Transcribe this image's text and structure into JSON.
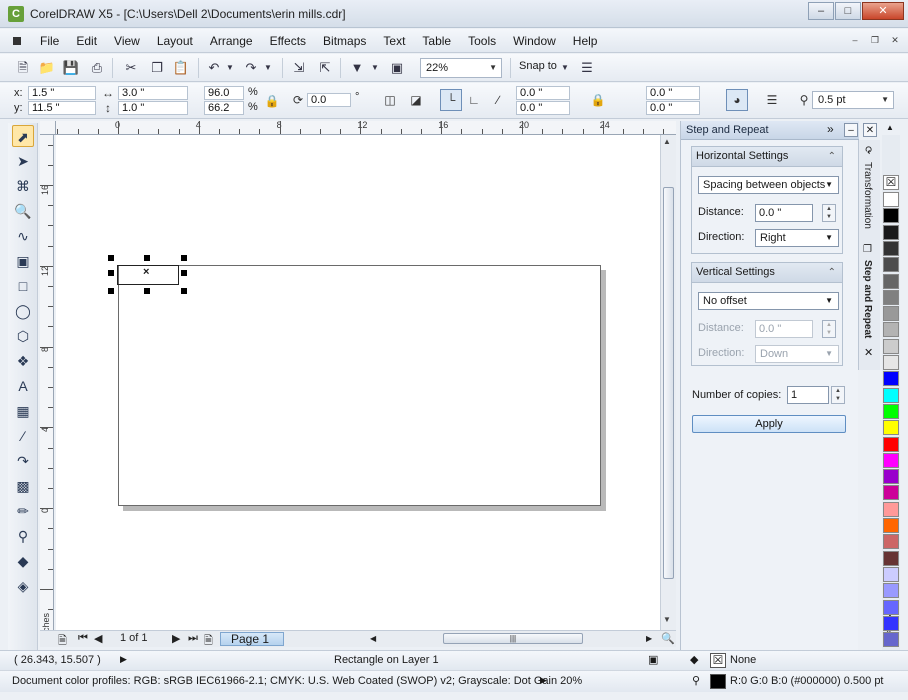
{
  "window": {
    "title": "CorelDRAW X5 - [C:\\Users\\Dell 2\\Documents\\erin mills.cdr]",
    "app_icon_letter": "C"
  },
  "menu": [
    "File",
    "Edit",
    "View",
    "Layout",
    "Arrange",
    "Effects",
    "Bitmaps",
    "Text",
    "Table",
    "Tools",
    "Window",
    "Help"
  ],
  "toolbar": {
    "zoom": "22%",
    "snap_label": "Snap to"
  },
  "property_bar": {
    "x_label": "x:",
    "x_value": "1.5 \"",
    "y_label": "y:",
    "y_value": "11.5 \"",
    "width_value": "3.0 \"",
    "height_value": "1.0 \"",
    "scale_w": "96.0",
    "scale_h": "66.2",
    "pct": "%",
    "rotation": "0.0",
    "degree": "°",
    "corner1": "0.0 \"",
    "corner2": "0.0 \"",
    "corner3": "0.0 \"",
    "corner4": "0.0 \"",
    "outline_width": "0.5 pt"
  },
  "ruler": {
    "units": "inches",
    "top_labels": [
      "0",
      "4",
      "8",
      "12",
      "16",
      "20",
      "24"
    ],
    "left_labels": [
      "16",
      "12",
      "8",
      "4",
      "0"
    ],
    "left_units": "inches"
  },
  "page_nav": {
    "page_count": "1 of 1",
    "page_tab": "Page 1"
  },
  "docker": {
    "title": "Step and Repeat",
    "horizontal": {
      "title": "Horizontal Settings",
      "mode": "Spacing between objects",
      "distance_label": "Distance:",
      "distance_value": "0.0 \"",
      "direction_label": "Direction:",
      "direction_value": "Right"
    },
    "vertical": {
      "title": "Vertical Settings",
      "mode": "No offset",
      "distance_label": "Distance:",
      "distance_value": "0.0 \"",
      "direction_label": "Direction:",
      "direction_value": "Down"
    },
    "copies_label": "Number of copies:",
    "copies_value": "1",
    "apply_label": "Apply",
    "tabs": [
      "Transformation",
      "Step and Repeat"
    ]
  },
  "palette_colors": [
    "#ffffff",
    "#000000",
    "#1a1a1a",
    "#333333",
    "#4d4d4d",
    "#666666",
    "#808080",
    "#999999",
    "#b3b3b3",
    "#cccccc",
    "#e6e6e6",
    "#0000ff",
    "#00ffff",
    "#00ff00",
    "#ffff00",
    "#ff0000",
    "#ff00ff",
    "#9900cc",
    "#cc0099",
    "#ff9999",
    "#ff6600",
    "#cc6666",
    "#663333",
    "#ccccff",
    "#9999ff",
    "#6666ff",
    "#3333ff",
    "#6666cc"
  ],
  "status": {
    "coords": "( 26.343, 15.507 )",
    "object_info": "Rectangle on Layer 1",
    "fill_label": "None",
    "color_profiles": "Document color profiles: RGB: sRGB IEC61966-2.1; CMYK: U.S. Web Coated (SWOP) v2; Grayscale: Dot Gain 20%",
    "outline_info": "R:0 G:0 B:0 (#000000)  0.500 pt"
  }
}
